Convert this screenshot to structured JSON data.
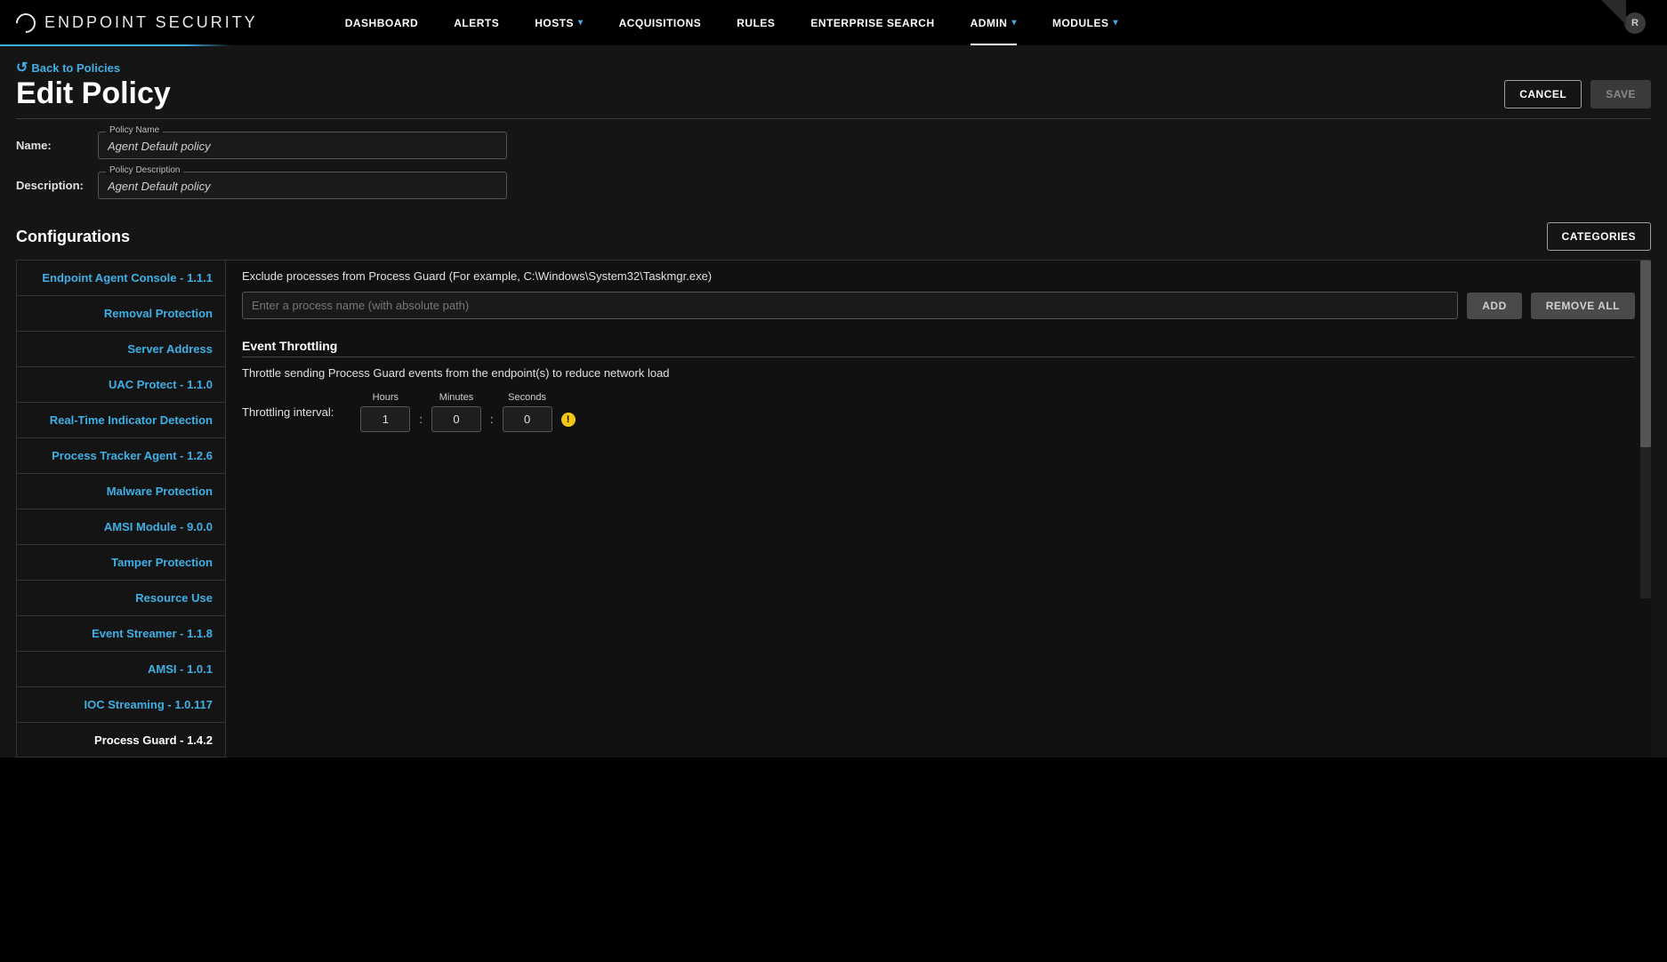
{
  "brand": "ENDPOINT SECURITY",
  "nav": [
    {
      "label": "DASHBOARD",
      "dropdown": false,
      "active": false
    },
    {
      "label": "ALERTS",
      "dropdown": false,
      "active": false
    },
    {
      "label": "HOSTS",
      "dropdown": true,
      "active": false
    },
    {
      "label": "ACQUISITIONS",
      "dropdown": false,
      "active": false
    },
    {
      "label": "RULES",
      "dropdown": false,
      "active": false
    },
    {
      "label": "ENTERPRISE SEARCH",
      "dropdown": false,
      "active": false
    },
    {
      "label": "ADMIN",
      "dropdown": true,
      "active": true
    },
    {
      "label": "MODULES",
      "dropdown": true,
      "active": false
    }
  ],
  "avatar_initial": "R",
  "back_link": "Back to Policies",
  "page_title": "Edit Policy",
  "buttons": {
    "cancel": "CANCEL",
    "save": "SAVE",
    "categories": "CATEGORIES",
    "add": "ADD",
    "remove_all": "REMOVE ALL"
  },
  "form": {
    "name_label": "Name:",
    "name_legend": "Policy Name",
    "name_value": "Agent Default policy",
    "desc_label": "Description:",
    "desc_legend": "Policy Description",
    "desc_value": "Agent Default policy"
  },
  "config_title": "Configurations",
  "sidebar_items": [
    {
      "label": "Endpoint Agent Console - 1.1.1",
      "active": false
    },
    {
      "label": "Removal Protection",
      "active": false
    },
    {
      "label": "Server Address",
      "active": false
    },
    {
      "label": "UAC Protect - 1.1.0",
      "active": false
    },
    {
      "label": "Real-Time Indicator Detection",
      "active": false
    },
    {
      "label": "Process Tracker Agent - 1.2.6",
      "active": false
    },
    {
      "label": "Malware Protection",
      "active": false
    },
    {
      "label": "AMSI Module - 9.0.0",
      "active": false
    },
    {
      "label": "Tamper Protection",
      "active": false
    },
    {
      "label": "Resource Use",
      "active": false
    },
    {
      "label": "Event Streamer - 1.1.8",
      "active": false
    },
    {
      "label": "AMSI - 1.0.1",
      "active": false
    },
    {
      "label": "IOC Streaming - 1.0.117",
      "active": false
    },
    {
      "label": "Process Guard - 1.4.2",
      "active": true
    }
  ],
  "exclusion": {
    "hint": "Exclude processes from Process Guard (For example, C:\\Windows\\System32\\Taskmgr.exe)",
    "placeholder": "Enter a process name (with absolute path)"
  },
  "throttling": {
    "section_title": "Event Throttling",
    "desc": "Throttle sending Process Guard events from the endpoint(s) to reduce network load",
    "label": "Throttling interval:",
    "hours_label": "Hours",
    "minutes_label": "Minutes",
    "seconds_label": "Seconds",
    "hours": "1",
    "minutes": "0",
    "seconds": "0"
  }
}
